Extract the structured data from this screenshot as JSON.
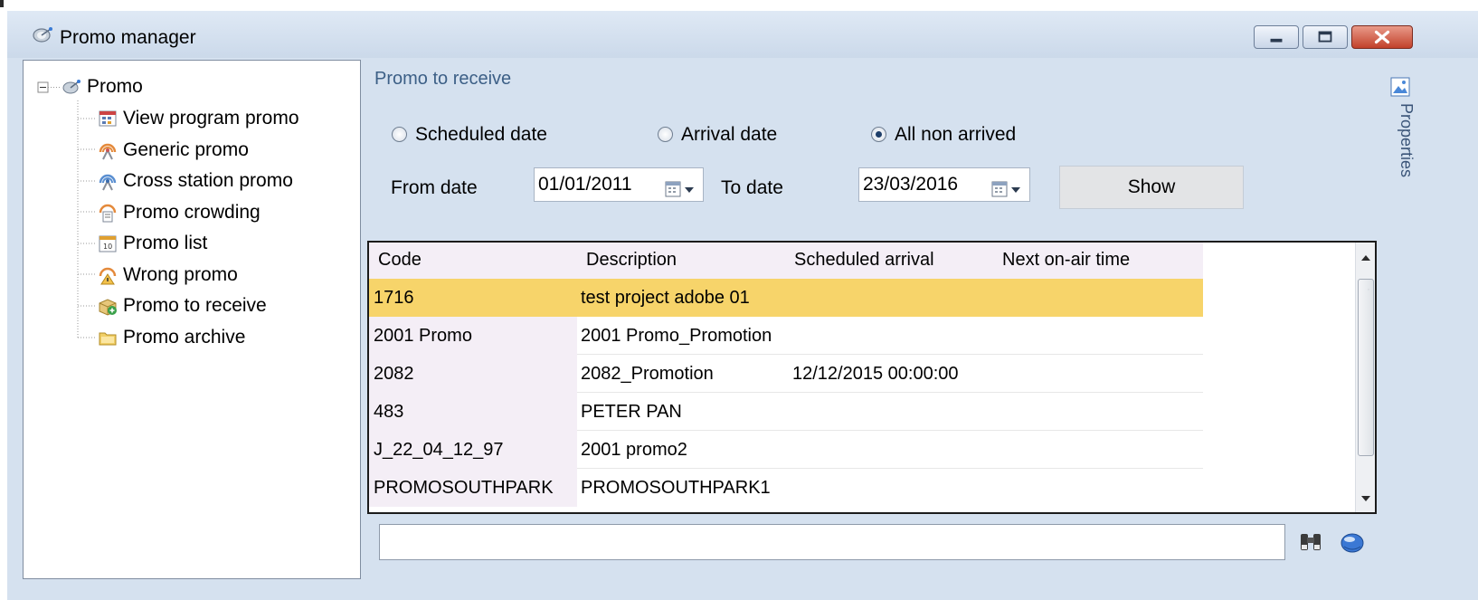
{
  "window": {
    "title": "Promo manager"
  },
  "tree": {
    "root": "Promo",
    "items": [
      {
        "label": "View program promo",
        "icon": "program-promo-icon"
      },
      {
        "label": "Generic promo",
        "icon": "generic-promo-icon"
      },
      {
        "label": "Cross station promo",
        "icon": "cross-station-promo-icon"
      },
      {
        "label": "Promo crowding",
        "icon": "promo-crowding-icon"
      },
      {
        "label": "Promo list",
        "icon": "promo-list-icon"
      },
      {
        "label": "Wrong promo",
        "icon": "wrong-promo-icon"
      },
      {
        "label": "Promo to receive",
        "icon": "promo-to-receive-icon"
      },
      {
        "label": "Promo archive",
        "icon": "promo-archive-icon"
      }
    ]
  },
  "panel": {
    "title": "Promo to receive",
    "radios": [
      {
        "label": "Scheduled date",
        "selected": false
      },
      {
        "label": "Arrival date",
        "selected": false
      },
      {
        "label": "All non arrived",
        "selected": true
      }
    ],
    "from_label": "From date",
    "from_value": "01/01/2011",
    "to_label": "To date",
    "to_value": "23/03/2016",
    "show_label": "Show"
  },
  "grid": {
    "columns": [
      "Code",
      "Description",
      "Scheduled arrival",
      "Next on-air time"
    ],
    "rows": [
      {
        "code": "1716",
        "description": "test project adobe 01",
        "scheduled": "",
        "next": "",
        "selected": true
      },
      {
        "code": "2001 Promo",
        "description": "2001 Promo_Promotion",
        "scheduled": "",
        "next": ""
      },
      {
        "code": "2082",
        "description": "2082_Promotion",
        "scheduled": "12/12/2015 00:00:00",
        "next": ""
      },
      {
        "code": "483",
        "description": "PETER PAN",
        "scheduled": "",
        "next": ""
      },
      {
        "code": "J_22_04_12_97",
        "description": "2001 promo2",
        "scheduled": "",
        "next": ""
      },
      {
        "code": "PROMOSOUTHPARK",
        "description": "PROMOSOUTHPARK1",
        "scheduled": "",
        "next": ""
      }
    ]
  },
  "search": {
    "value": "",
    "placeholder": ""
  },
  "side_panel": {
    "label": "Properties"
  },
  "colors": {
    "selection": "#f7d46a",
    "window_bg": "#d5e1ef",
    "title_accent": "#3c5f86"
  }
}
